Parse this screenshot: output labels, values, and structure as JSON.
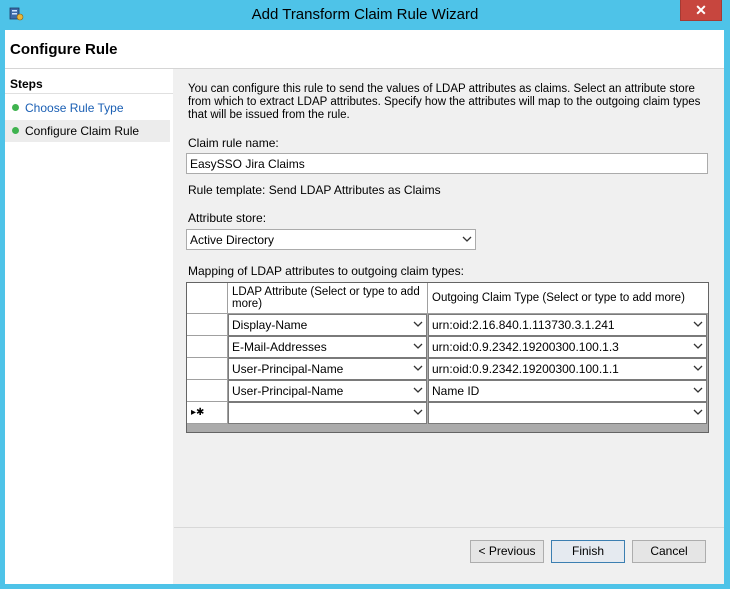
{
  "window": {
    "title": "Add Transform Claim Rule Wizard",
    "close_glyph": "✕"
  },
  "header": {
    "title": "Configure Rule"
  },
  "steps": {
    "title": "Steps",
    "items": [
      {
        "label": "Choose Rule Type"
      },
      {
        "label": "Configure Claim Rule"
      }
    ]
  },
  "content": {
    "description": "You can configure this rule to send the values of LDAP attributes as claims. Select an attribute store from which to extract LDAP attributes. Specify how the attributes will map to the outgoing claim types that will be issued from the rule.",
    "claim_rule_name_label": "Claim rule name:",
    "claim_rule_name_value": "EasySSO Jira Claims",
    "rule_template": "Rule template: Send LDAP Attributes as Claims",
    "attribute_store_label": "Attribute store:",
    "attribute_store_value": "Active Directory",
    "mapping_label": "Mapping of LDAP attributes to outgoing claim types:",
    "grid": {
      "col_ldap": "LDAP Attribute (Select or type to add more)",
      "col_claim": "Outgoing Claim Type (Select or type to add more)",
      "new_row_marker": "▸✱",
      "rows": [
        {
          "ldap": "Display-Name",
          "claim": "urn:oid:2.16.840.1.113730.3.1.241"
        },
        {
          "ldap": "E-Mail-Addresses",
          "claim": "urn:oid:0.9.2342.19200300.100.1.3"
        },
        {
          "ldap": "User-Principal-Name",
          "claim": "urn:oid:0.9.2342.19200300.100.1.1"
        },
        {
          "ldap": "User-Principal-Name",
          "claim": "Name ID"
        }
      ]
    }
  },
  "buttons": {
    "previous": "< Previous",
    "finish": "Finish",
    "cancel": "Cancel"
  }
}
